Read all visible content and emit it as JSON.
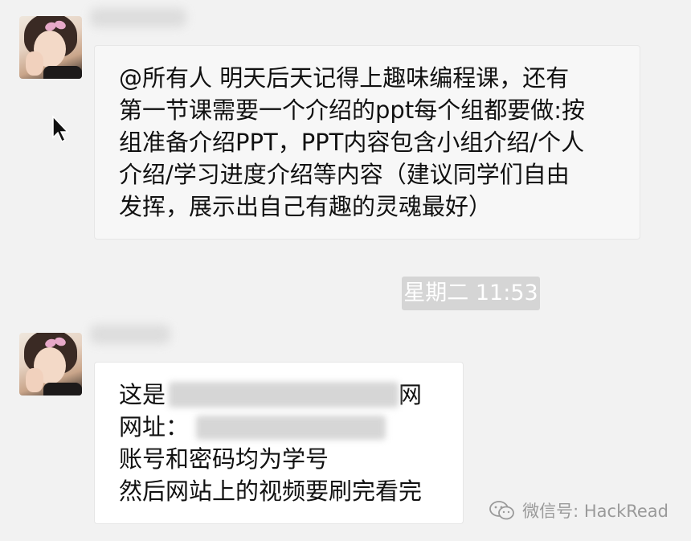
{
  "chat": {
    "messages": [
      {
        "lines": [
          "@所有人 明天后天记得上趣味编程课，还有",
          "第一节课需要一个介绍的ppt每个组都要做:按",
          "组准备介绍PPT，PPT内容包含小组介绍/个人",
          "介绍/学习进度介绍等内容（建议同学们自由",
          "发挥，展示出自己有趣的灵魂最好）"
        ]
      },
      {
        "line1_prefix": "这是",
        "line1_suffix": "网",
        "line2_prefix": "网址：",
        "line3": "账号和密码均为学号",
        "line4": "然后网站上的视频要刷完看完"
      }
    ],
    "timestamp": "星期二 11:53"
  },
  "watermark": {
    "text": "微信号: HackRead",
    "icon": "wechat-icon"
  }
}
